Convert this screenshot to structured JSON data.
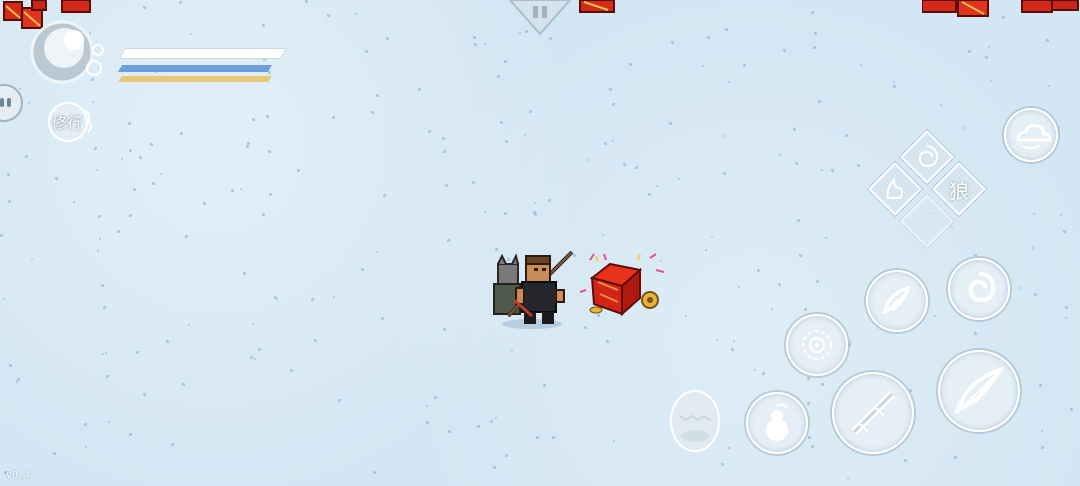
{
  "hud": {
    "cultivate_label": "修行",
    "health_color": "#ffffff",
    "mana_color": "#6f9fd8",
    "energy_color": "#e8c874"
  },
  "skills": {
    "wolf_glyph": "狼"
  },
  "version": "v0.4",
  "icons": [
    "lantern-icon",
    "pause-icon",
    "character-portrait-icon",
    "chat-icon",
    "cultivate-icon",
    "cloud-icon",
    "whirl-icon",
    "flame-icon",
    "wolf-icon",
    "feather-icon",
    "spiral-icon",
    "vortex-icon",
    "gourd-icon",
    "staff-strike-icon",
    "slash-icon",
    "egg-icon",
    "treasure-chest-icon"
  ]
}
